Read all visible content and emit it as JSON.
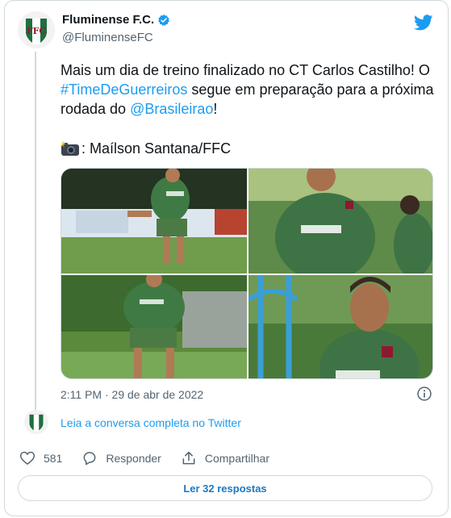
{
  "author": {
    "display_name": "Fluminense F.C.",
    "handle": "@FluminenseFC",
    "verified": true,
    "avatar_icon": "fluminense-crest-icon"
  },
  "tweet": {
    "text_before": "Mais um dia de treino finalizado no CT Carlos Castilho! O ",
    "hashtag": "#TimeDeGuerreiros",
    "text_middle": " segue em preparação para a próxima rodada do ",
    "mention": "@Brasileirao",
    "text_after": "!",
    "credit_icon": "camera-flash-icon",
    "credit": ": Maílson Santana/FFC",
    "timestamp": "2:11 PM · 29 de abr de 2022"
  },
  "media": [
    "training-photo-1",
    "training-photo-2",
    "training-photo-3",
    "training-photo-4"
  ],
  "conversation": {
    "label": "Leia a conversa completa no Twitter"
  },
  "actions": {
    "likes": "581",
    "reply_label": "Responder",
    "share_label": "Compartilhar"
  },
  "footer": {
    "read_replies_label": "Ler 32 respostas"
  },
  "colors": {
    "link": "#1d9bf0",
    "muted": "#536471",
    "border": "#cfd9de",
    "crest_green": "#1f6e3f",
    "crest_maroon": "#8b1a2f"
  }
}
